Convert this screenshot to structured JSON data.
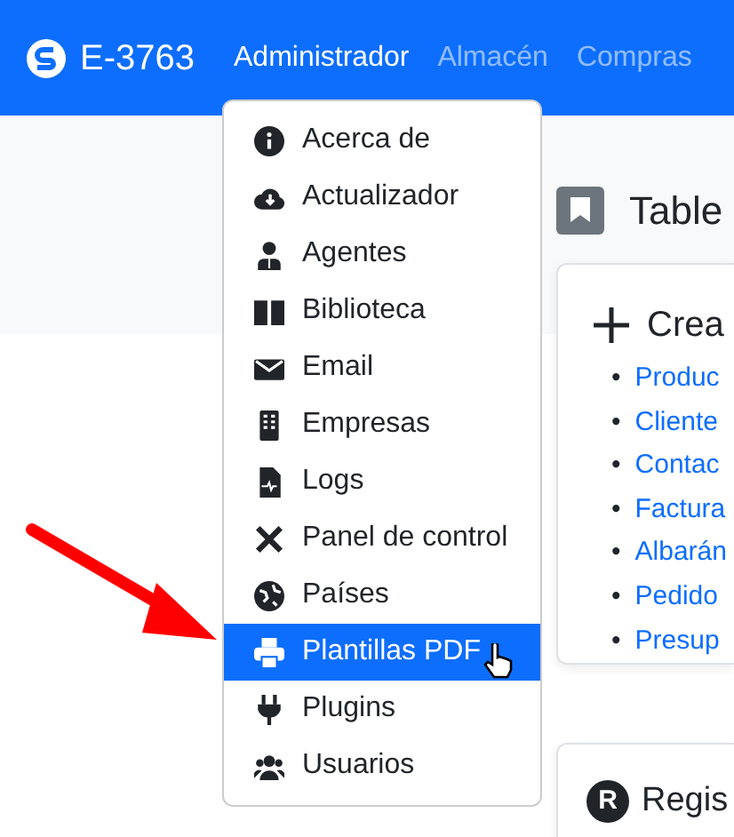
{
  "navbar": {
    "brand": "E-3763",
    "links": [
      {
        "label": "Administrador",
        "selected": true
      },
      {
        "label": "Almacén",
        "selected": false
      },
      {
        "label": "Compras",
        "selected": false
      }
    ]
  },
  "dropdown": {
    "items": [
      {
        "label": "Acerca de",
        "selected": false
      },
      {
        "label": "Actualizador",
        "selected": false
      },
      {
        "label": "Agentes",
        "selected": false
      },
      {
        "label": "Biblioteca",
        "selected": false
      },
      {
        "label": "Email",
        "selected": false
      },
      {
        "label": "Empresas",
        "selected": false
      },
      {
        "label": "Logs",
        "selected": false
      },
      {
        "label": "Panel de control",
        "selected": false
      },
      {
        "label": "Países",
        "selected": false
      },
      {
        "label": "Plantillas PDF",
        "selected": true
      },
      {
        "label": "Plugins",
        "selected": false
      },
      {
        "label": "Usuarios",
        "selected": false
      }
    ]
  },
  "page_title": "Table",
  "create_card": {
    "title": "Crea",
    "links": [
      {
        "bullet": "•",
        "label": "Produc"
      },
      {
        "bullet": "•",
        "label": "Cliente"
      },
      {
        "bullet": "•",
        "label": "Contac"
      },
      {
        "bullet": "•",
        "label": "Factura"
      },
      {
        "bullet": "•",
        "label": "Albarán"
      },
      {
        "bullet": "•",
        "label": "Pedido"
      },
      {
        "bullet": "•",
        "label": "Presup"
      }
    ]
  },
  "register_card": {
    "icon_letter": "R",
    "title": "Regis"
  }
}
